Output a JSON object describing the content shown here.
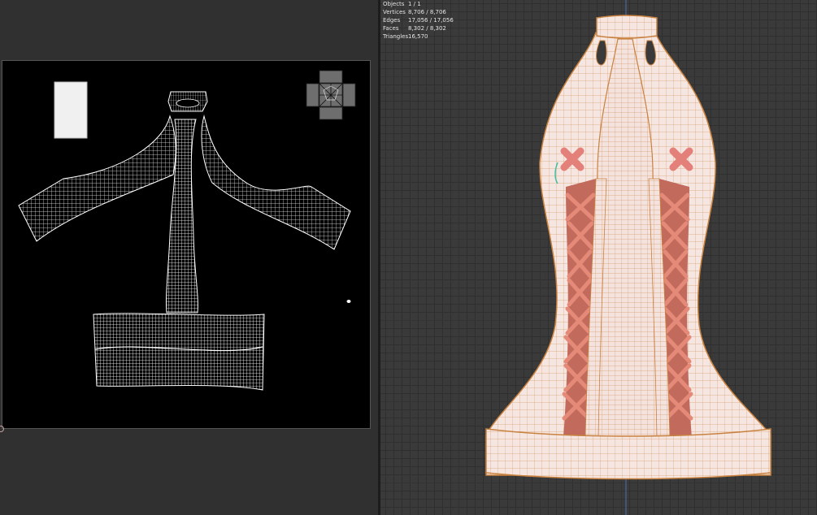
{
  "viewport_stats": [
    {
      "label": "Objects",
      "value": "1 / 1"
    },
    {
      "label": "Vertices",
      "value": "8,706 / 8,706"
    },
    {
      "label": "Edges",
      "value": "17,056 / 17,056"
    },
    {
      "label": "Faces",
      "value": "8,302 / 8,302"
    },
    {
      "label": "Triangles",
      "value": "16,570"
    }
  ],
  "colors": {
    "uv_background": "#000000",
    "uv_wire": "#ffffff",
    "uv_selected_island": "#6e6e6e",
    "viewport_background": "#3a3a3a",
    "mesh_body": "#f6e6e2",
    "mesh_wire": "#d08a45",
    "lace": "#d9705f",
    "axis_blue": "#4f6fb8"
  }
}
